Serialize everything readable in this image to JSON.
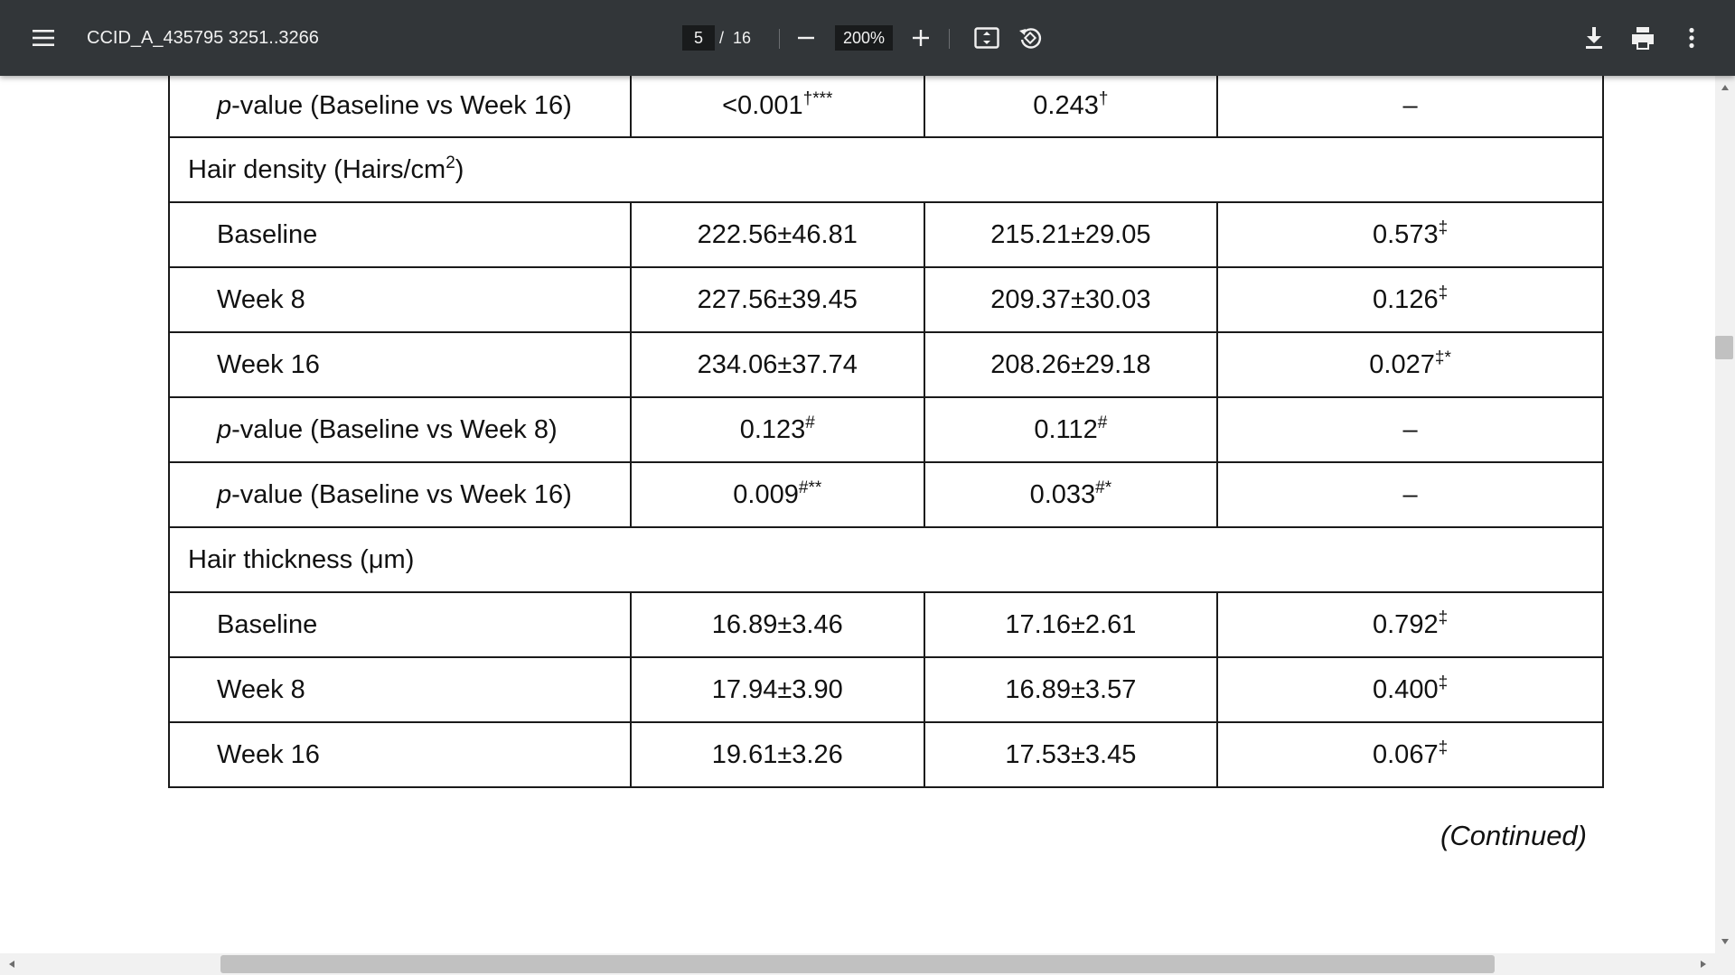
{
  "toolbar": {
    "title": "CCID_A_435795 3251..3266",
    "page_current": "5",
    "page_separator": "/",
    "page_total": "16",
    "zoom_value": "200%",
    "icons": [
      "menu-icon",
      "minus-icon",
      "plus-icon",
      "fit-page-icon",
      "rotate-icon",
      "download-icon",
      "print-icon",
      "more-vert-icon"
    ],
    "icon_color": "#f1f1f1",
    "background_color": "#323639"
  },
  "table": {
    "row0": {
      "label_italic": "p",
      "label_rest": "-value (Baseline vs Week 16)",
      "c1": "<0.001",
      "c1_sup": "†***",
      "c2": "0.243",
      "c2_sup": "†",
      "c3": "–",
      "c3_sup": ""
    },
    "section1": {
      "label": "Hair density (Hairs/cm",
      "label_sup": "2",
      "label_end": ")"
    },
    "row1": {
      "label": "Baseline",
      "c1": "222.56±46.81",
      "c2": "215.21±29.05",
      "c3": "0.573",
      "c3_sup": "‡"
    },
    "row2": {
      "label": "Week 8",
      "c1": "227.56±39.45",
      "c2": "209.37±30.03",
      "c3": "0.126",
      "c3_sup": "‡"
    },
    "row3": {
      "label": "Week 16",
      "c1": "234.06±37.74",
      "c2": "208.26±29.18",
      "c3": "0.027",
      "c3_sup": "‡*"
    },
    "row4": {
      "label_italic": "p",
      "label_rest": "-value (Baseline vs Week 8)",
      "c1": "0.123",
      "c1_sup": "#",
      "c2": "0.112",
      "c2_sup": "#",
      "c3": "–"
    },
    "row5": {
      "label_italic": "p",
      "label_rest": "-value (Baseline vs Week 16)",
      "c1": "0.009",
      "c1_sup": "#**",
      "c2": "0.033",
      "c2_sup": "#*",
      "c3": "–"
    },
    "section2": {
      "label": "Hair thickness (μm)"
    },
    "row6": {
      "label": "Baseline",
      "c1": "16.89±3.46",
      "c2": "17.16±2.61",
      "c3": "0.792",
      "c3_sup": "‡"
    },
    "row7": {
      "label": "Week 8",
      "c1": "17.94±3.90",
      "c2": "16.89±3.57",
      "c3": "0.400",
      "c3_sup": "‡"
    },
    "row8": {
      "label": "Week 16",
      "c1": "19.61±3.26",
      "c2": "17.53±3.45",
      "c3": "0.067",
      "c3_sup": "‡"
    }
  },
  "continued": "(Continued)"
}
